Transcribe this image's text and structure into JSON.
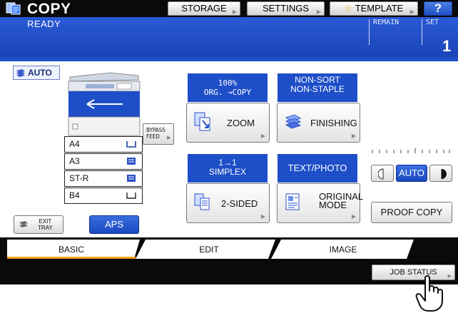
{
  "header": {
    "title": "COPY",
    "buttons": {
      "storage": "STORAGE",
      "settings": "SETTINGS",
      "template": "TEMPLATE",
      "help": "?"
    }
  },
  "status": {
    "text": "READY",
    "remain_label": "REMAIN",
    "set_label": "SET",
    "set_value": "1"
  },
  "paper": {
    "auto_label": "AUTO",
    "trays": [
      "A4",
      "A3",
      "ST-R",
      "B4"
    ],
    "bypass_line1": "BYPASS",
    "bypass_line2": "FEED"
  },
  "zoom": {
    "head_line1": "100%",
    "head_line2": "ORG. →COPY",
    "label": "ZOOM"
  },
  "finishing": {
    "head_line1": "NON-SORT",
    "head_line2": "NON-STAPLE",
    "label": "FINISHING"
  },
  "duplex": {
    "head_line1": "1→1",
    "head_line2": "SIMPLEX",
    "label": "2-SIDED"
  },
  "original": {
    "head": "TEXT/PHOTO",
    "label_line1": "ORIGINAL",
    "label_line2": "MODE"
  },
  "exposure": {
    "auto_label": "AUTO"
  },
  "proof_copy": "PROOF COPY",
  "exit_tray": {
    "line1": "EXIT",
    "line2": "TRAY"
  },
  "aps": "APS",
  "tabs": {
    "basic": "BASIC",
    "edit": "EDIT",
    "image": "IMAGE"
  },
  "job_status": "JOB STATUS",
  "colors": {
    "accent_blue": "#1e4fc8",
    "tab_active_underline": "#f0a31e",
    "bar_black": "#0a0a0a"
  }
}
